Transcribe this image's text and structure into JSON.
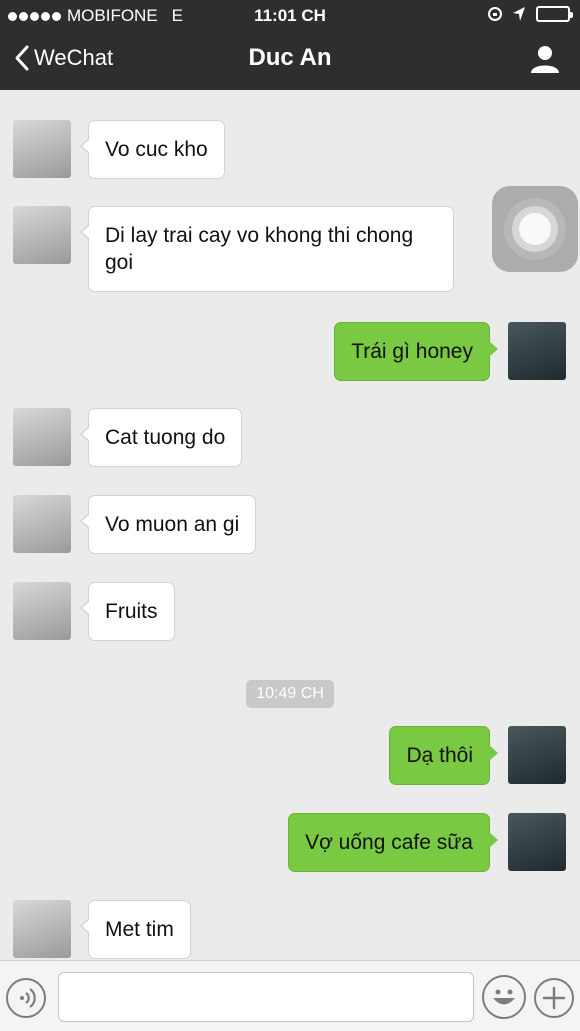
{
  "status_bar": {
    "carrier": "MOBIFONE",
    "network": "E",
    "time": "11:01 CH"
  },
  "nav": {
    "back_label": "WeChat",
    "title": "Duc An"
  },
  "messages": [
    {
      "side": "in",
      "text": "Vo cuc kho"
    },
    {
      "side": "in",
      "text": "Di lay trai cay vo khong thi chong goi"
    },
    {
      "side": "out",
      "text": "Trái gì honey"
    },
    {
      "side": "in",
      "text": "Cat tuong do"
    },
    {
      "side": "in",
      "text": "Vo muon an gi"
    },
    {
      "side": "in",
      "text": "Fruits"
    },
    {
      "side": "out",
      "text": "Dạ thôi"
    },
    {
      "side": "out",
      "text": "Vợ uống cafe sữa"
    },
    {
      "side": "in",
      "text": "Met tim"
    }
  ],
  "timestamp": "10:49 CH",
  "icons": {
    "back": "chevron-left-icon",
    "profile": "person-icon",
    "voice": "voice-icon",
    "emoji": "smiley-icon",
    "plus": "plus-icon"
  },
  "colors": {
    "outgoing_bubble": "#7ac943",
    "navbar": "#2e2e30",
    "chat_background": "#ebebeb"
  }
}
